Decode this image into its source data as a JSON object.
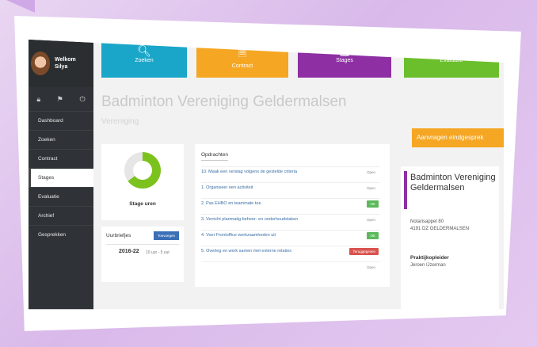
{
  "user": {
    "welcome": "Welkom",
    "name": "Silya"
  },
  "sidebar": {
    "items": [
      {
        "label": "Dashboard"
      },
      {
        "label": "Zoeken"
      },
      {
        "label": "Contract"
      },
      {
        "label": "Stages"
      },
      {
        "label": "Evaluatie"
      },
      {
        "label": "Archief"
      },
      {
        "label": "Gesprekken"
      }
    ],
    "active_index": 3
  },
  "tiles": [
    {
      "label": "Zoeken",
      "icon": "search-icon",
      "color": "#1aa6c8"
    },
    {
      "label": "Contract",
      "icon": "document-icon",
      "color": "#f5a623"
    },
    {
      "label": "Stages",
      "icon": "building-icon",
      "color": "#8e2fa3"
    },
    {
      "label": "Evaluatie",
      "icon": "checkbox-icon",
      "color": "#6cbf2c"
    }
  ],
  "page": {
    "title": "Badminton Vereniging Geldermalsen",
    "subtitle": "Vereniging",
    "cta_label": "Aanvragen eindgesprek"
  },
  "stage": {
    "label": "Stage uren",
    "progress": 0.65
  },
  "uurbriefjes": {
    "title": "Uurbriefjes",
    "button": "Toevoegen",
    "year": "2016-22",
    "time": "10 uur - 5 uur"
  },
  "opdrachten": {
    "tab": "Opdrachten",
    "tasks": [
      {
        "text": "10. Maak een verslag volgens de gestelde criteria",
        "status": "Open",
        "kind": "open"
      },
      {
        "text": "1. Organiseer een activiteit",
        "status": "Open",
        "kind": "open"
      },
      {
        "text": "2. Pas EHBO en teammate toe",
        "status": "OK",
        "kind": "ok"
      },
      {
        "text": "3. Verricht planmatig beheer- en onderhoudstaken",
        "status": "Open",
        "kind": "open"
      },
      {
        "text": "4. Voer Frontoffice werkzaamheden uit",
        "status": "OK",
        "kind": "ok"
      },
      {
        "text": "5. Overleg en werk samen met externe relaties",
        "status": "Teruggegeven",
        "kind": "ter"
      },
      {
        "text": "",
        "status": "Open",
        "kind": "open"
      }
    ]
  },
  "organisation": {
    "name": "Badminton Vereniging Geldermalsen",
    "address1": "Notarisappel 80",
    "address2": "4191 DZ GELDERMALSEN",
    "role": "Praktijkopleider",
    "person": "Jeroen IJzerman"
  }
}
